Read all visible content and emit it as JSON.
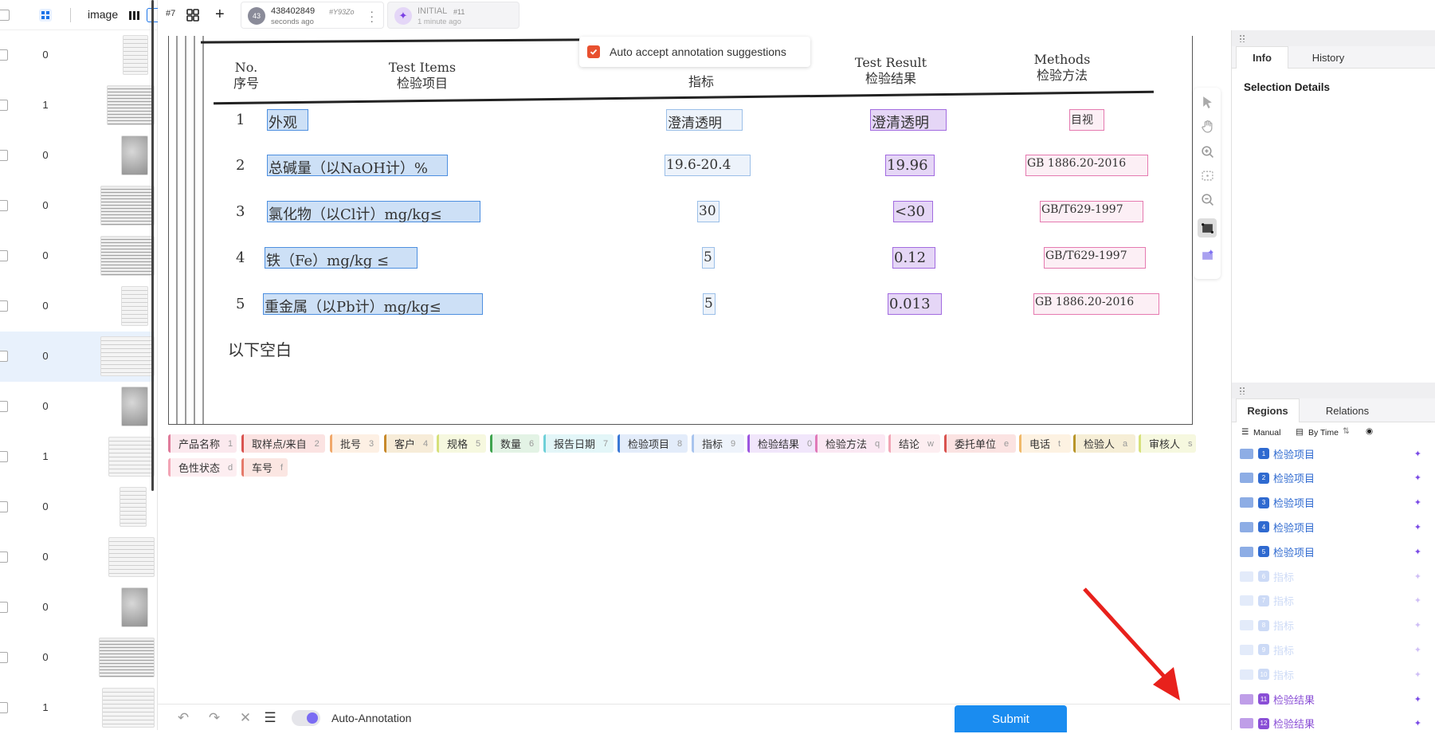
{
  "left_panel": {
    "header_view_label": "image",
    "rows": [
      {
        "count": "0",
        "thumb": "doc"
      },
      {
        "count": "1",
        "thumb": "wide"
      },
      {
        "count": "0",
        "thumb": "dark"
      },
      {
        "count": "0",
        "thumb": "wide"
      },
      {
        "count": "0",
        "thumb": "wide"
      },
      {
        "count": "0",
        "thumb": "doc"
      },
      {
        "count": "0",
        "thumb": "doc"
      },
      {
        "count": "0",
        "thumb": "dark"
      },
      {
        "count": "1",
        "thumb": "doc"
      },
      {
        "count": "0",
        "thumb": "doc"
      },
      {
        "count": "0",
        "thumb": "doc"
      },
      {
        "count": "0",
        "thumb": "dark"
      },
      {
        "count": "0",
        "thumb": "wide"
      },
      {
        "count": "1",
        "thumb": "doc"
      }
    ]
  },
  "topbar": {
    "task_number": "#7",
    "annotation": {
      "avatar": "43",
      "name": "438402849",
      "id": "#Y93Zo",
      "time": "seconds ago"
    },
    "prediction": {
      "name": "INITIAL",
      "id": "#11",
      "time": "1 minute ago"
    }
  },
  "popup": {
    "label": "Auto accept annotation suggestions"
  },
  "document": {
    "headers": {
      "no_en": "No.",
      "no_zh": "序号",
      "items_en": "Test Items",
      "items_zh": "检验项目",
      "spec_zh": "指标",
      "result_en": "Test Result",
      "result_zh": "检验结果",
      "method_en": "Methods",
      "method_zh": "检验方法"
    },
    "rows": [
      {
        "no": "1",
        "item": "外观",
        "spec": "澄清透明",
        "result": "澄清透明",
        "method": "目视"
      },
      {
        "no": "2",
        "item": "总碱量（以NaOH计）%",
        "spec": "19.6-20.4",
        "result": "19.96",
        "method": "GB 1886.20-2016"
      },
      {
        "no": "3",
        "item": "氯化物（以Cl计）mg/kg≤",
        "spec": "30",
        "result": "<30",
        "method": "GB/T629-1997"
      },
      {
        "no": "4",
        "item": "铁（Fe）mg/kg ≤",
        "spec": "5",
        "result": "0.12",
        "method": "GB/T629-1997"
      },
      {
        "no": "5",
        "item": "重金属（以Pb计）mg/kg≤",
        "spec": "5",
        "result": "0.013",
        "method": "GB 1886.20-2016"
      }
    ],
    "footer": "以下空白"
  },
  "labels": [
    {
      "name": "产品名称",
      "key": "1",
      "color": "#e07b9a",
      "bg": "#fbe9ee"
    },
    {
      "name": "取样点/来自",
      "key": "2",
      "color": "#d9534f",
      "bg": "#fbe3e2"
    },
    {
      "name": "批号",
      "key": "3",
      "color": "#f0a86a",
      "bg": "#fdf0e4"
    },
    {
      "name": "客户",
      "key": "4",
      "color": "#c7892b",
      "bg": "#f7ecd8"
    },
    {
      "name": "规格",
      "key": "5",
      "color": "#d6e07a",
      "bg": "#f6f8df"
    },
    {
      "name": "数量",
      "key": "6",
      "color": "#3ea34e",
      "bg": "#e3f3e5"
    },
    {
      "name": "报告日期",
      "key": "7",
      "color": "#6fd0d8",
      "bg": "#e3f6f8"
    },
    {
      "name": "检验项目",
      "key": "8",
      "color": "#3a78d6",
      "bg": "#e3ecfa"
    },
    {
      "name": "指标",
      "key": "9",
      "color": "#a8c4ee",
      "bg": "#eef3fb"
    },
    {
      "name": "检验结果",
      "key": "0",
      "color": "#9c55e0",
      "bg": "#f1e6fb"
    },
    {
      "name": "检验方法",
      "key": "q",
      "color": "#e07ab8",
      "bg": "#fbe8f3"
    },
    {
      "name": "结论",
      "key": "w",
      "color": "#f2a5b5",
      "bg": "#fdeef1"
    },
    {
      "name": "委托单位",
      "key": "e",
      "color": "#d9534f",
      "bg": "#fbe3e2"
    },
    {
      "name": "电话",
      "key": "t",
      "color": "#f0b96a",
      "bg": "#fdf2e2"
    },
    {
      "name": "检验人",
      "key": "a",
      "color": "#b8952a",
      "bg": "#f6eed6"
    },
    {
      "name": "审核人",
      "key": "s",
      "color": "#d6e07a",
      "bg": "#f6f8df"
    },
    {
      "name": "色性状态",
      "key": "d",
      "color": "#f2a5b5",
      "bg": "#fdeef1"
    },
    {
      "name": "车号",
      "key": "f",
      "color": "#e57a6a",
      "bg": "#fbe6e2"
    }
  ],
  "bottom": {
    "auto_annotation_label": "Auto-Annotation",
    "submit_label": "Submit"
  },
  "right_panel": {
    "tabs": [
      "Info",
      "History"
    ],
    "selection_details": "Selection Details",
    "region_tabs": [
      "Regions",
      "Relations"
    ],
    "sort_manual": "Manual",
    "sort_by_time": "By Time",
    "regions": [
      {
        "index": "1",
        "label": "检验项目",
        "color": "#2f6ad0",
        "faded": false
      },
      {
        "index": "2",
        "label": "检验项目",
        "color": "#2f6ad0",
        "faded": false
      },
      {
        "index": "3",
        "label": "检验项目",
        "color": "#2f6ad0",
        "faded": false
      },
      {
        "index": "4",
        "label": "检验项目",
        "color": "#2f6ad0",
        "faded": false
      },
      {
        "index": "5",
        "label": "检验项目",
        "color": "#2f6ad0",
        "faded": false
      },
      {
        "index": "6",
        "label": "指标",
        "color": "#6f96e6",
        "faded": true
      },
      {
        "index": "7",
        "label": "指标",
        "color": "#6f96e6",
        "faded": true
      },
      {
        "index": "8",
        "label": "指标",
        "color": "#6f96e6",
        "faded": true
      },
      {
        "index": "9",
        "label": "指标",
        "color": "#6f96e6",
        "faded": true
      },
      {
        "index": "10",
        "label": "指标",
        "color": "#6f96e6",
        "faded": true
      },
      {
        "index": "11",
        "label": "检验结果",
        "color": "#8a4fd6",
        "faded": false
      },
      {
        "index": "12",
        "label": "检验结果",
        "color": "#8a4fd6",
        "faded": false
      }
    ]
  }
}
